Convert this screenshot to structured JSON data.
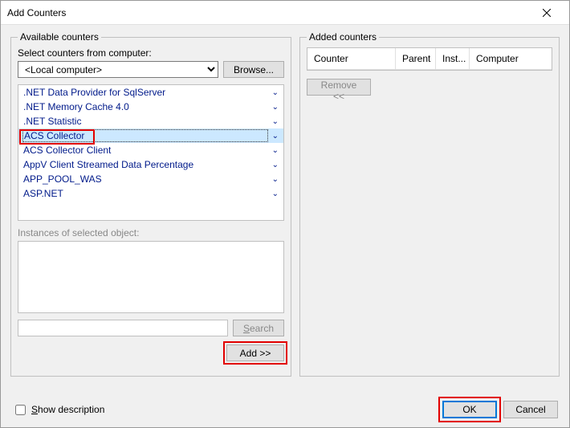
{
  "window": {
    "title": "Add Counters"
  },
  "left": {
    "legend": "Available counters",
    "selectLabel": "Select counters from computer:",
    "computer": "<Local computer>",
    "browse": "Browse...",
    "items": [
      ".NET Data Provider for SqlServer",
      ".NET Memory Cache 4.0",
      ".NET Statistic",
      "ACS Collector",
      "ACS Collector Client",
      "AppV Client Streamed Data Percentage",
      "APP_POOL_WAS",
      "ASP.NET"
    ],
    "selectedIndex": 3,
    "instancesLabel": "Instances of selected object:",
    "search": "Search",
    "add": "Add >>"
  },
  "right": {
    "legend": "Added counters",
    "cols": {
      "c1": "Counter",
      "c2": "Parent",
      "c3": "Inst...",
      "c4": "Computer"
    },
    "remove": "Remove <<"
  },
  "bottom": {
    "showDesc": "how description",
    "ok": "OK",
    "cancel": "Cancel"
  }
}
